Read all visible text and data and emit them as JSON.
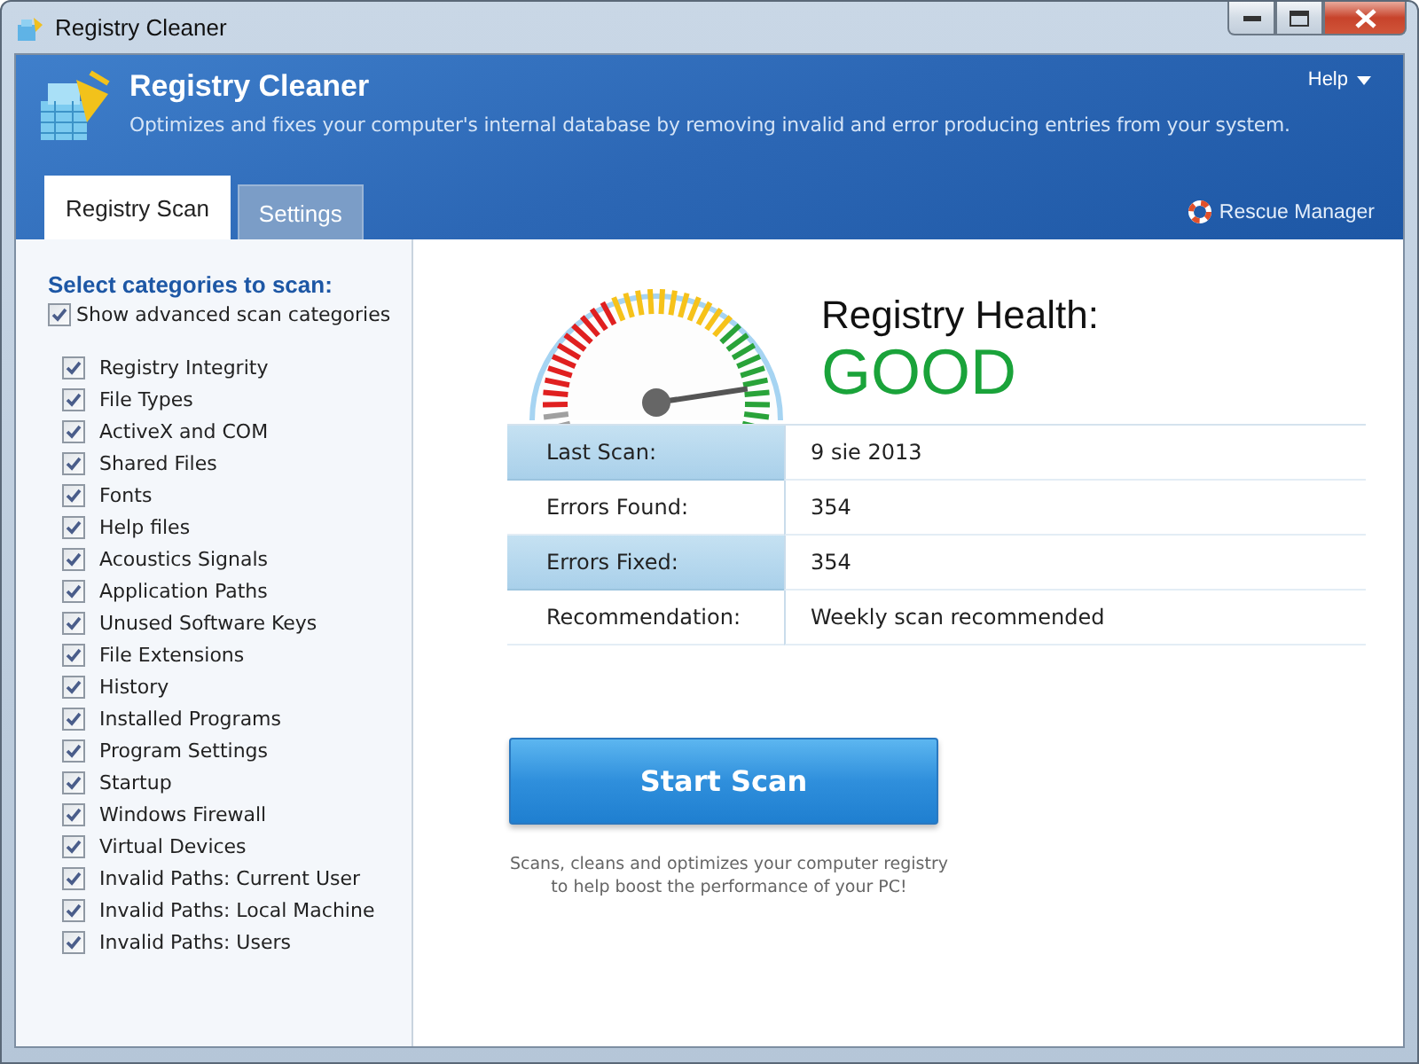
{
  "window": {
    "title": "Registry Cleaner"
  },
  "header": {
    "title": "Registry Cleaner",
    "subtitle": "Optimizes and fixes your computer's internal database by removing invalid and error producing entries from your system.",
    "help": "Help"
  },
  "tabs": [
    {
      "label": "Registry Scan",
      "selected": true
    },
    {
      "label": "Settings",
      "selected": false
    }
  ],
  "rescue_manager": "Rescue Manager",
  "sidebar": {
    "heading": "Select categories to scan:",
    "advanced": {
      "label": "Show advanced scan categories",
      "checked": true
    },
    "items": [
      {
        "label": "Registry Integrity",
        "checked": true
      },
      {
        "label": "File Types",
        "checked": true
      },
      {
        "label": "ActiveX and COM",
        "checked": true
      },
      {
        "label": "Shared Files",
        "checked": true
      },
      {
        "label": "Fonts",
        "checked": true
      },
      {
        "label": "Help files",
        "checked": true
      },
      {
        "label": "Acoustics Signals",
        "checked": true
      },
      {
        "label": "Application Paths",
        "checked": true
      },
      {
        "label": "Unused Software Keys",
        "checked": true
      },
      {
        "label": "File Extensions",
        "checked": true
      },
      {
        "label": "History",
        "checked": true
      },
      {
        "label": "Installed Programs",
        "checked": true
      },
      {
        "label": "Program Settings",
        "checked": true
      },
      {
        "label": "Startup",
        "checked": true
      },
      {
        "label": "Windows Firewall",
        "checked": true
      },
      {
        "label": "Virtual Devices",
        "checked": true
      },
      {
        "label": "Invalid Paths: Current User",
        "checked": true
      },
      {
        "label": "Invalid Paths: Local Machine",
        "checked": true
      },
      {
        "label": "Invalid Paths: Users",
        "checked": true
      }
    ]
  },
  "health": {
    "title": "Registry Health:",
    "status": "GOOD"
  },
  "stats": [
    {
      "label": "Last Scan:",
      "value": "9 sie 2013"
    },
    {
      "label": "Errors Found:",
      "value": "354"
    },
    {
      "label": "Errors Fixed:",
      "value": "354"
    },
    {
      "label": "Recommendation:",
      "value": "Weekly scan recommended"
    }
  ],
  "scan_button": "Start Scan",
  "caption": "Scans, cleans and optimizes your computer registry to help boost the performance of your PC!"
}
